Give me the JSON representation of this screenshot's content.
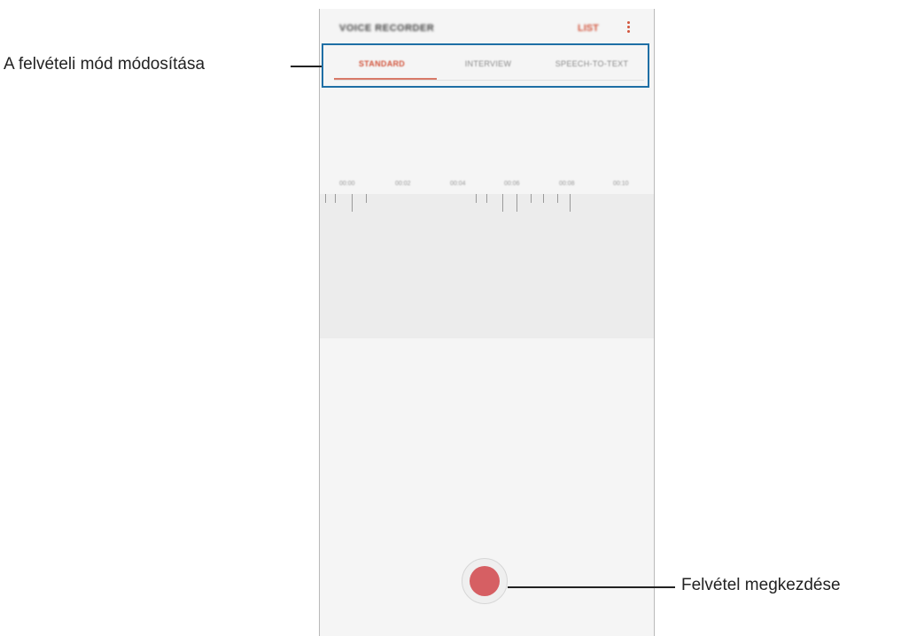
{
  "app": {
    "title": "VOICE RECORDER",
    "list_label": "LIST",
    "more_icon": "more-vertical-icon"
  },
  "tabs": [
    {
      "label": "STANDARD",
      "active": true
    },
    {
      "label": "INTERVIEW",
      "active": false
    },
    {
      "label": "SPEECH-TO-TEXT",
      "active": false
    }
  ],
  "timeline": {
    "labels": [
      "00:00",
      "00:02",
      "00:04",
      "00:06",
      "00:08",
      "00:10"
    ]
  },
  "record": {
    "icon": "record-icon",
    "color": "#d65f63"
  },
  "annotations": {
    "mode_label": "A felvételi mód módosítása",
    "record_label": "Felvétel megkezdése",
    "highlight_color": "#1f6fa5"
  },
  "colors": {
    "accent": "#d2553d",
    "record": "#d65f63"
  }
}
